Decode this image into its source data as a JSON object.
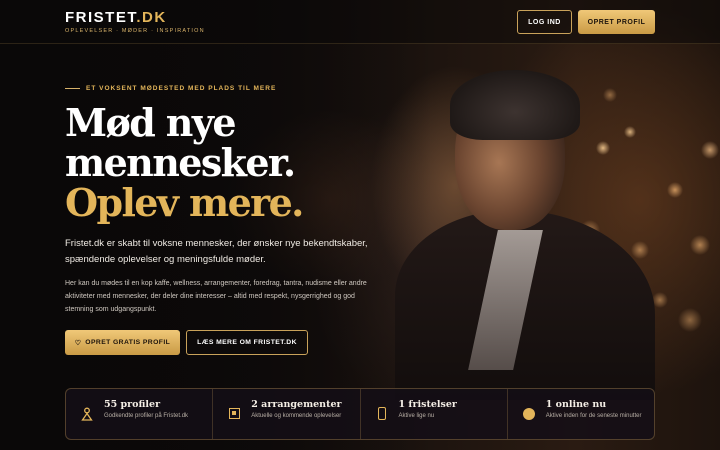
{
  "brand": {
    "name": "FRISTET",
    "suffix": ".DK",
    "tagline": "OPLEVELSER · MØDER · INSPIRATION"
  },
  "nav": {
    "login_label": "LOG IND",
    "create_label": "OPRET PROFIL"
  },
  "hero": {
    "eyebrow": "ET VOKSENT MØDESTED MED PLADS TIL MERE",
    "headline_1": "Mød nye",
    "headline_2": "mennesker.",
    "headline_3": "Oplev mere.",
    "lead": "Fristet.dk er skabt til voksne mennesker, der ønsker nye bekendtskaber, spændende oplevelser og meningsfulde møder.",
    "body": "Her kan du mødes til en kop kaffe, wellness, arrangementer, foredrag, tantra, nudisme eller andre aktiviteter med mennesker, der deler dine interesser – altid med respekt, nysgerrighed og god stemning som udgangspunkt.",
    "cta_primary": "OPRET GRATIS PROFIL",
    "cta_primary_icon": "♡",
    "cta_secondary": "LÆS MERE OM FRISTET.DK"
  },
  "stats": [
    {
      "icon": "person-icon",
      "title": "55 profiler",
      "subtitle": "Godkendte profiler på Fristet.dk"
    },
    {
      "icon": "calendar-icon",
      "title": "2 arrangementer",
      "subtitle": "Aktuelle og kommende oplevelser"
    },
    {
      "icon": "phone-icon",
      "title": "1 fristelser",
      "subtitle": "Aktive lige nu"
    },
    {
      "icon": "online-dot-icon",
      "title": "1 online nu",
      "subtitle": "Aktive inden for de seneste minutter"
    }
  ],
  "colors": {
    "accent": "#e3b55a",
    "background": "#0d0a0a"
  }
}
